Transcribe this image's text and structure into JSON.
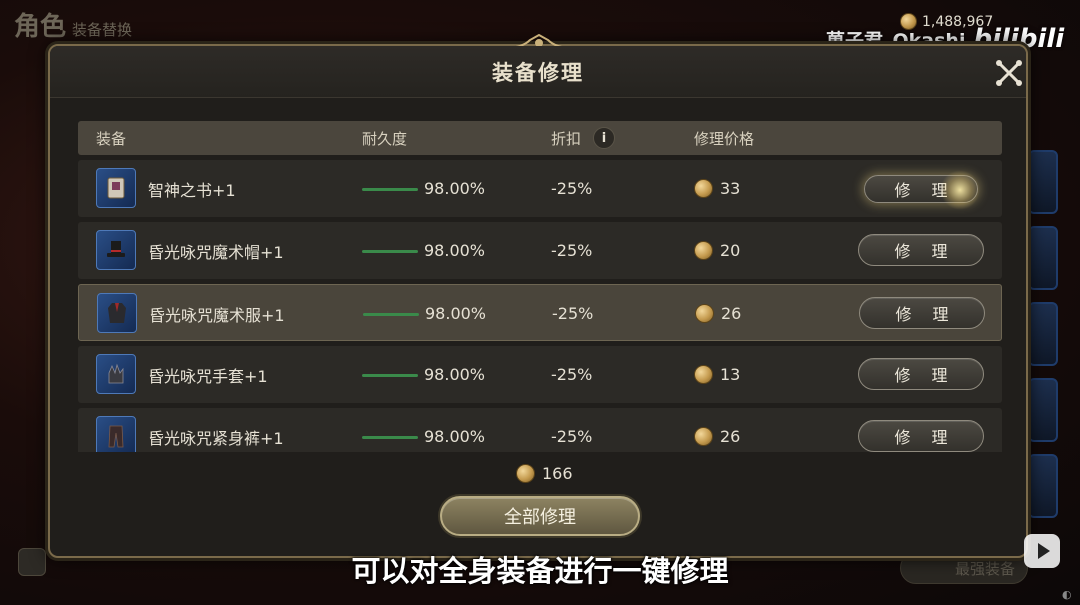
{
  "background": {
    "title_main": "角色",
    "title_sub": "装备替换",
    "currency_amount": "1,488,967",
    "bottom_button_label": "最强装备"
  },
  "watermark": {
    "user": "菓子君_Okashi",
    "site": "bilibili"
  },
  "dialog": {
    "title": "装备修理",
    "headers": {
      "equipment": "装备",
      "durability": "耐久度",
      "discount": "折扣",
      "price": "修理价格"
    },
    "info_icon_glyph": "i",
    "repair_label": "修 理",
    "rows": [
      {
        "name": "智神之书+1",
        "durability": "98.00%",
        "durability_fraction": 0.98,
        "discount": "-25%",
        "price": "33",
        "icon": "book-icon",
        "highlighted": false
      },
      {
        "name": "昏光咏咒魔术帽+1",
        "durability": "98.00%",
        "durability_fraction": 0.98,
        "discount": "-25%",
        "price": "20",
        "icon": "hat-icon",
        "highlighted": false
      },
      {
        "name": "昏光咏咒魔术服+1",
        "durability": "98.00%",
        "durability_fraction": 0.98,
        "discount": "-25%",
        "price": "26",
        "icon": "robe-icon",
        "highlighted": true
      },
      {
        "name": "昏光咏咒手套+1",
        "durability": "98.00%",
        "durability_fraction": 0.98,
        "discount": "-25%",
        "price": "13",
        "icon": "gloves-icon",
        "highlighted": false
      },
      {
        "name": "昏光咏咒紧身裤+1",
        "durability": "98.00%",
        "durability_fraction": 0.98,
        "discount": "-25%",
        "price": "26",
        "icon": "pants-icon",
        "highlighted": false
      }
    ],
    "total_price": "166",
    "repair_all_label": "全部修理"
  },
  "subtitle": "可以对全身装备进行一键修理",
  "colors": {
    "durability_bar": "#3a8a4a",
    "coin_gold": "#c49a4e",
    "item_frame_blue": "#2a4e86"
  }
}
